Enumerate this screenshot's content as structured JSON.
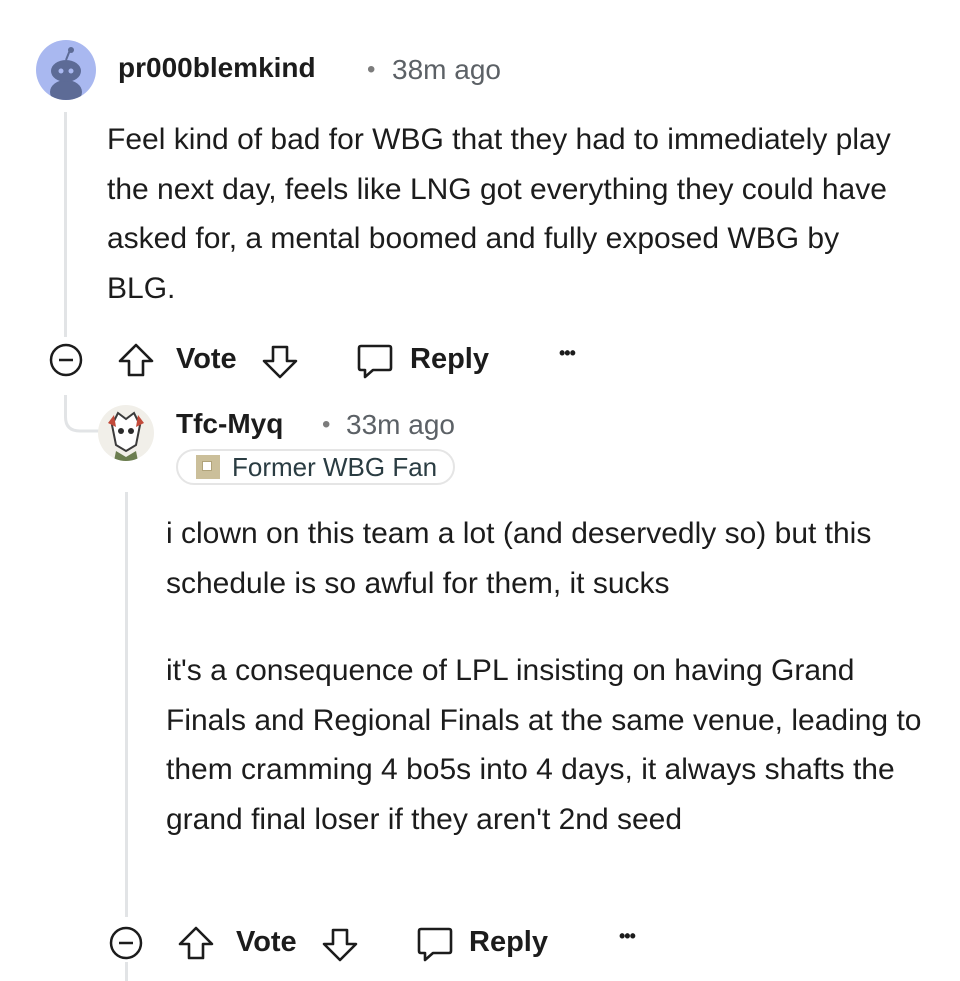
{
  "comments": [
    {
      "username": "pr000blemkind",
      "separator": "•",
      "time": "38m ago",
      "paragraphs": [
        "Feel kind of bad for WBG that they had to immediately play the next day, feels like LNG got everything they could have asked for, a mental boomed and fully exposed WBG by BLG."
      ],
      "actions": {
        "vote": "Vote",
        "reply": "Reply",
        "more": "•••"
      }
    },
    {
      "username": "Tfc-Myq",
      "separator": "•",
      "time": "33m ago",
      "flair": "Former WBG Fan",
      "paragraphs": [
        "i clown on this team a lot (and deservedly so) but this schedule is so awful for them, it sucks",
        "it's a consequence of LPL insisting on having Grand Finals and Regional Finals at the same venue, leading to them cramming 4 bo5s into 4 days, it always shafts the grand final loser if they aren't 2nd seed"
      ],
      "actions": {
        "vote": "Vote",
        "reply": "Reply",
        "more": "•••"
      }
    }
  ],
  "colors": {
    "text": "#1c1c1c",
    "meta": "#5c6166",
    "thread_line": "#e2e4e6",
    "avatar_bg": "#a9b8f0"
  },
  "icons": [
    "reddit-snoo-avatar-icon",
    "collapse-icon",
    "upvote-icon",
    "downvote-icon",
    "reply-bubble-icon",
    "more-icon",
    "flair-badge-icon"
  ]
}
